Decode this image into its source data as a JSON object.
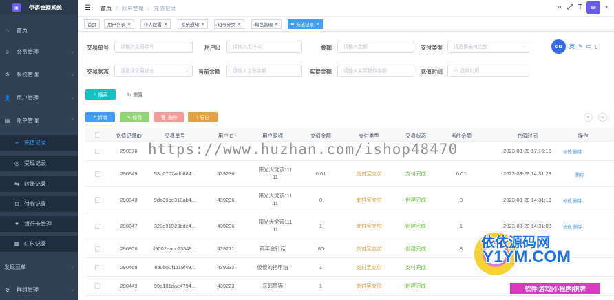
{
  "app": {
    "title": "伊语管理系统",
    "logo_text": "IM"
  },
  "sidebar": {
    "items": [
      {
        "label": "首页",
        "icon": "dashboard-icon"
      },
      {
        "label": "会员管理",
        "icon": "member-icon"
      },
      {
        "label": "系统管理",
        "icon": "gear-icon"
      },
      {
        "label": "用户管理",
        "icon": "user-icon"
      },
      {
        "label": "账单管理",
        "icon": "bill-icon"
      },
      {
        "label": "发现菜单",
        "icon": "discover-icon"
      },
      {
        "label": "群组管理",
        "icon": "group-icon"
      }
    ],
    "sub_items": [
      {
        "label": "充值记录",
        "icon": "recharge-icon"
      },
      {
        "label": "提现记录",
        "icon": "withdraw-icon"
      },
      {
        "label": "转账记录",
        "icon": "transfer-icon"
      },
      {
        "label": "付款记录",
        "icon": "payment-icon"
      },
      {
        "label": "银行卡管理",
        "icon": "bankcard-icon"
      },
      {
        "label": "红包记录",
        "icon": "redpacket-icon"
      }
    ]
  },
  "header": {
    "breadcrumb": [
      "首页",
      "账单管理",
      "充值记录"
    ],
    "avatar": "IM"
  },
  "tags": [
    "首页",
    "用户列表",
    "个人设置",
    "系统通知",
    "短号分类",
    "角色管理",
    "充值记录"
  ],
  "search": {
    "fields": [
      {
        "label": "交易单号",
        "placeholder": "请输入交易单号"
      },
      {
        "label": "用户Id",
        "placeholder": "请输入用户ID"
      },
      {
        "label": "金额",
        "placeholder": "请输入金额"
      },
      {
        "label": "支付类型",
        "placeholder": "请选择支付类型"
      },
      {
        "label": "交易状态",
        "placeholder": "请选择交易状态"
      },
      {
        "label": "当前余额",
        "placeholder": "请输入当前余额"
      },
      {
        "label": "实提金额",
        "placeholder": "请输入实际操作金额"
      },
      {
        "label": "充值时间",
        "placeholder": "选择时间"
      }
    ],
    "search_button": "搜索",
    "reset_button": "重置"
  },
  "toolbar": {
    "add": "新增",
    "edit": "修改",
    "delete": "删除",
    "export": "导出"
  },
  "right_widget": {
    "badge": "du",
    "lang": "英"
  },
  "table": {
    "columns": [
      "充值记录ID",
      "交易单号",
      "用户ID",
      "用户昵称",
      "充值金额",
      "支付类型",
      "交易状态",
      "当前余额",
      "充值时间",
      "操作"
    ],
    "rows": [
      {
        "id": "290876",
        "order": "",
        "uid": "",
        "nick": "",
        "amount": "",
        "pay": "",
        "status": "",
        "balance": "",
        "time": "2023-03-29 17:16:16",
        "ops": "修改 删除"
      },
      {
        "id": "290849",
        "order": "53d07074db684...",
        "uid": "439236",
        "nick": "阳光大觉该111 11",
        "amount": "0.01",
        "pay": "支付宝支付",
        "status": "支付完成",
        "balance": "0.01",
        "time": "2023-03-29 14:31:29",
        "ops": "删除"
      },
      {
        "id": "290848",
        "order": "9da39be310ab4...",
        "uid": "439236",
        "nick": "阳光大觉该111 11",
        "amount": "0",
        "pay": "支付宝支付",
        "status": "创建完成",
        "balance": "0",
        "time": "2023-03-29 14:31:18",
        "ops": "修改 删除"
      },
      {
        "id": "290847",
        "order": "320e91923bde4...",
        "uid": "439236",
        "nick": "阳光大觉该111 11",
        "amount": "1",
        "pay": "支付宝支付",
        "status": "创建完成",
        "balance": "1",
        "time": "2023-03-29 14:31:08",
        "ops": "修改 删除"
      },
      {
        "id": "290806",
        "order": "f9002eacc23549...",
        "uid": "439271",
        "nick": "商年金针菇",
        "amount": "80",
        "pay": "支付宝支付",
        "status": "创建完成",
        "balance": "8",
        "time": "",
        "ops": ""
      },
      {
        "id": "290468",
        "order": "ea0b50f1119f49...",
        "uid": "439232",
        "nick": "傻傻的指甲油",
        "amount": "1",
        "pay": "支付宝支付",
        "status": "支付完成",
        "balance": "",
        "time": "",
        "ops": ""
      },
      {
        "id": "290449",
        "order": "99a181dae4794...",
        "uid": "439223",
        "nick": "东郭墨猫",
        "amount": "1",
        "pay": "支付宝支付",
        "status": "创建完成",
        "balance": "",
        "time": "",
        "ops": ""
      }
    ]
  },
  "watermark": {
    "url": "https://www.huzhan.com/ishop48470",
    "site_title": "依依源码网",
    "site_domain": "Y1YM.COM",
    "site_tagline": "软件|游戏|小程序|棋牌"
  }
}
